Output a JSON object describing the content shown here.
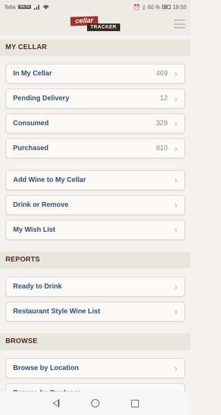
{
  "status_bar": {
    "carrier": "Telia",
    "volte": "VoLTE",
    "battery": "60 %",
    "time": "19:50"
  },
  "header": {
    "logo_top": "cellar",
    "logo_bottom": "TRACKER"
  },
  "sections": {
    "my_cellar": {
      "title": "MY CELLAR",
      "items": [
        {
          "label": "In My Cellar",
          "count": "469"
        },
        {
          "label": "Pending Delivery",
          "count": "12"
        },
        {
          "label": "Consumed",
          "count": "329"
        },
        {
          "label": "Purchased",
          "count": "810"
        },
        {
          "label": "Add Wine to My Cellar"
        },
        {
          "label": "Drink or Remove"
        },
        {
          "label": "My Wish List"
        }
      ]
    },
    "reports": {
      "title": "REPORTS",
      "items": [
        {
          "label": "Ready to Drink"
        },
        {
          "label": "Restaurant Style Wine List"
        }
      ]
    },
    "browse": {
      "title": "BROWSE",
      "items": [
        {
          "label": "Browse by Location"
        },
        {
          "label": "Browse by Producer"
        }
      ]
    }
  },
  "chevron": "›"
}
